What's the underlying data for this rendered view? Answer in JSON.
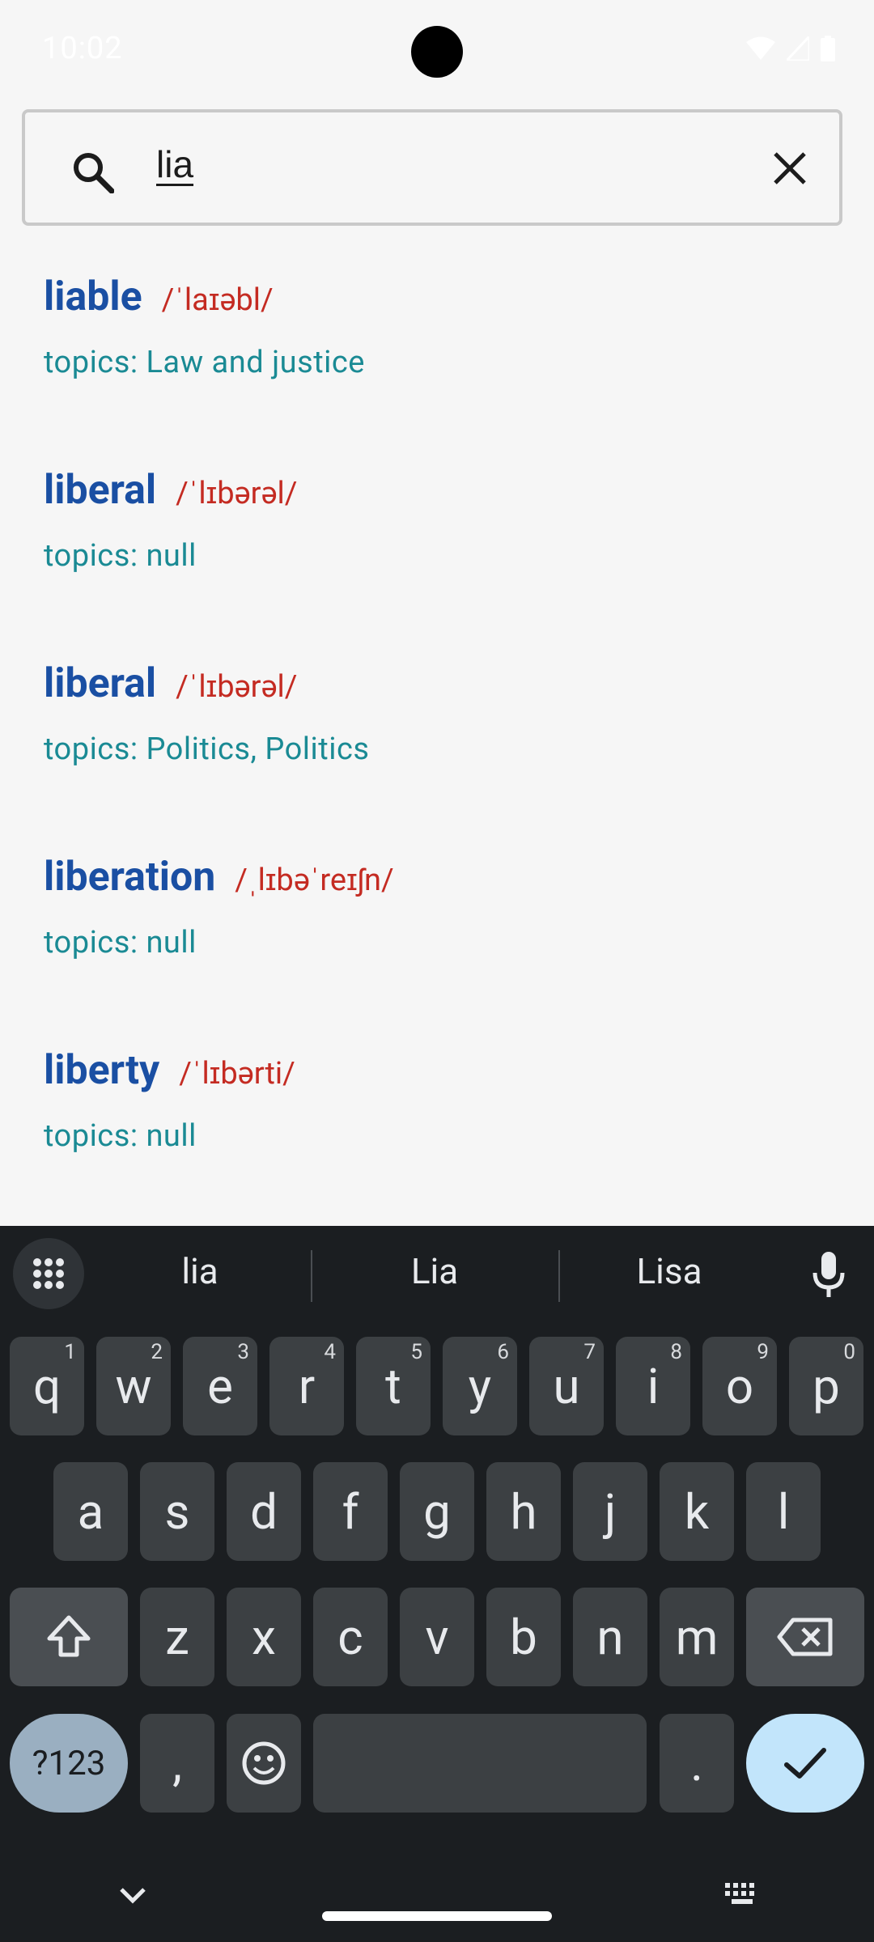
{
  "status_bar": {
    "time": "10:02"
  },
  "search": {
    "query": "lia"
  },
  "results": [
    {
      "word": "liable",
      "pronunciation": "/ˈlaɪəbl/",
      "topics": "topics: Law and justice"
    },
    {
      "word": "liberal",
      "pronunciation": "/ˈlɪbərəl/",
      "topics": "topics: null"
    },
    {
      "word": "liberal",
      "pronunciation": "/ˈlɪbərəl/",
      "topics": "topics: Politics, Politics"
    },
    {
      "word": "liberation",
      "pronunciation": "/ˌlɪbəˈreɪʃn/",
      "topics": "topics: null"
    },
    {
      "word": "liberty",
      "pronunciation": "/ˈlɪbərti/",
      "topics": "topics: null"
    }
  ],
  "keyboard": {
    "suggestions": [
      "lia",
      "Lia",
      "Lisa"
    ],
    "row1": [
      {
        "key": "q",
        "hint": "1"
      },
      {
        "key": "w",
        "hint": "2"
      },
      {
        "key": "e",
        "hint": "3"
      },
      {
        "key": "r",
        "hint": "4"
      },
      {
        "key": "t",
        "hint": "5"
      },
      {
        "key": "y",
        "hint": "6"
      },
      {
        "key": "u",
        "hint": "7"
      },
      {
        "key": "i",
        "hint": "8"
      },
      {
        "key": "o",
        "hint": "9"
      },
      {
        "key": "p",
        "hint": "0"
      }
    ],
    "row2": [
      "a",
      "s",
      "d",
      "f",
      "g",
      "h",
      "j",
      "k",
      "l"
    ],
    "row3": [
      "z",
      "x",
      "c",
      "v",
      "b",
      "n",
      "m"
    ],
    "symbols_label": "?123",
    "comma": ",",
    "period": "."
  },
  "colors": {
    "word": "#1a4fa3",
    "pronunciation": "#c42b22",
    "topics": "#1a8a94",
    "keyboard_bg": "#1b1e21",
    "key_bg": "#3c4043",
    "enter_bg": "#c2e5fb"
  }
}
